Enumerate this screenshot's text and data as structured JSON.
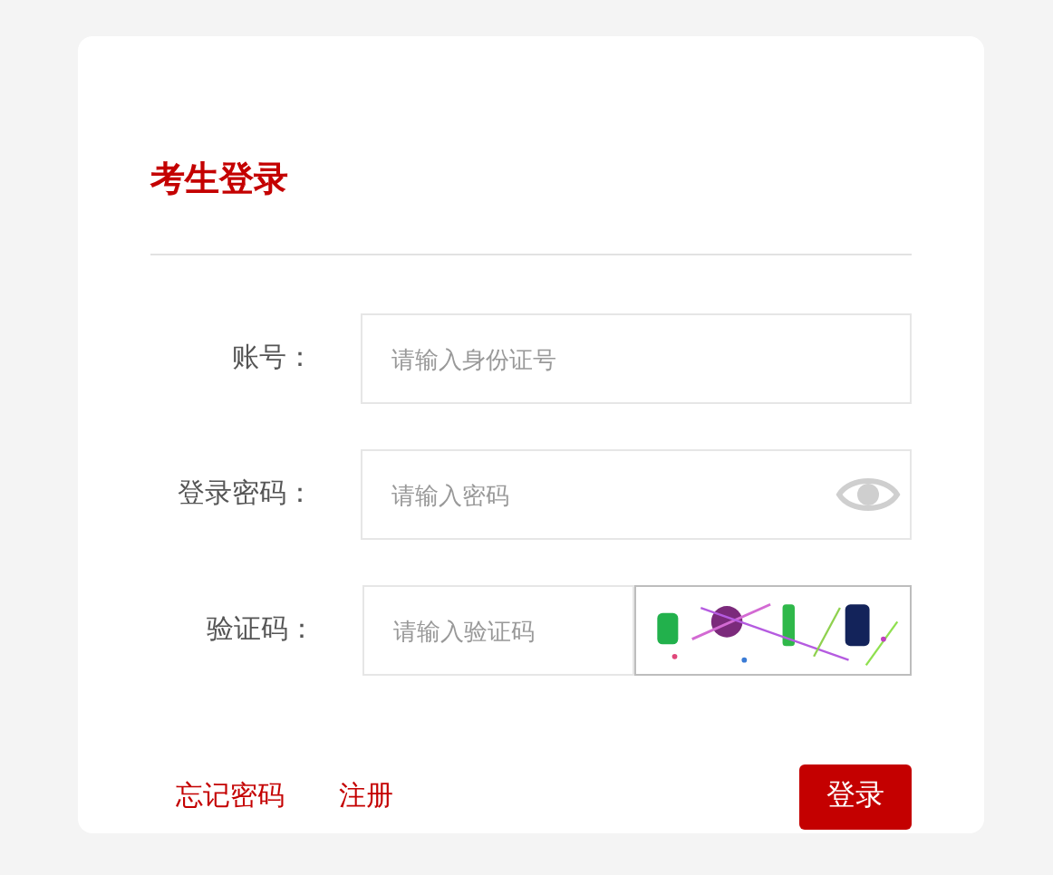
{
  "title": "考生登录",
  "fields": [
    {
      "kind": "text",
      "label": "账号：",
      "placeholder": "请输入身份证号"
    },
    {
      "kind": "password",
      "label": "登录密码：",
      "placeholder": "请输入密码"
    },
    {
      "kind": "captcha",
      "label": "验证码：",
      "placeholder": "请输入验证码"
    }
  ],
  "links": [
    "忘记密码",
    "注册"
  ],
  "submit": "登录"
}
